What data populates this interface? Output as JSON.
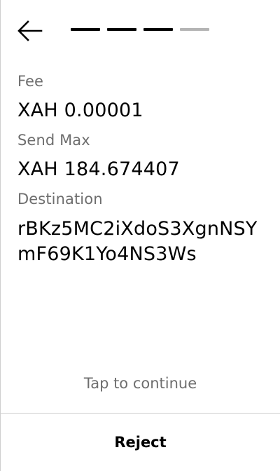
{
  "header": {
    "back_icon": "arrow-left-icon",
    "progress": {
      "total_steps": 4,
      "completed_steps": 3,
      "active_color": "#000000",
      "inactive_color": "#b4b4b4"
    }
  },
  "fields": {
    "fee": {
      "label": "Fee",
      "value": "XAH 0.00001"
    },
    "send_max": {
      "label": "Send Max",
      "value": "XAH 184.674407"
    },
    "destination": {
      "label": "Destination",
      "value": "rBKz5MC2iXdoS3XgnNSYmF69K1Yo4NS3Ws"
    }
  },
  "footer": {
    "hint": "Tap to continue",
    "reject_label": "Reject"
  }
}
